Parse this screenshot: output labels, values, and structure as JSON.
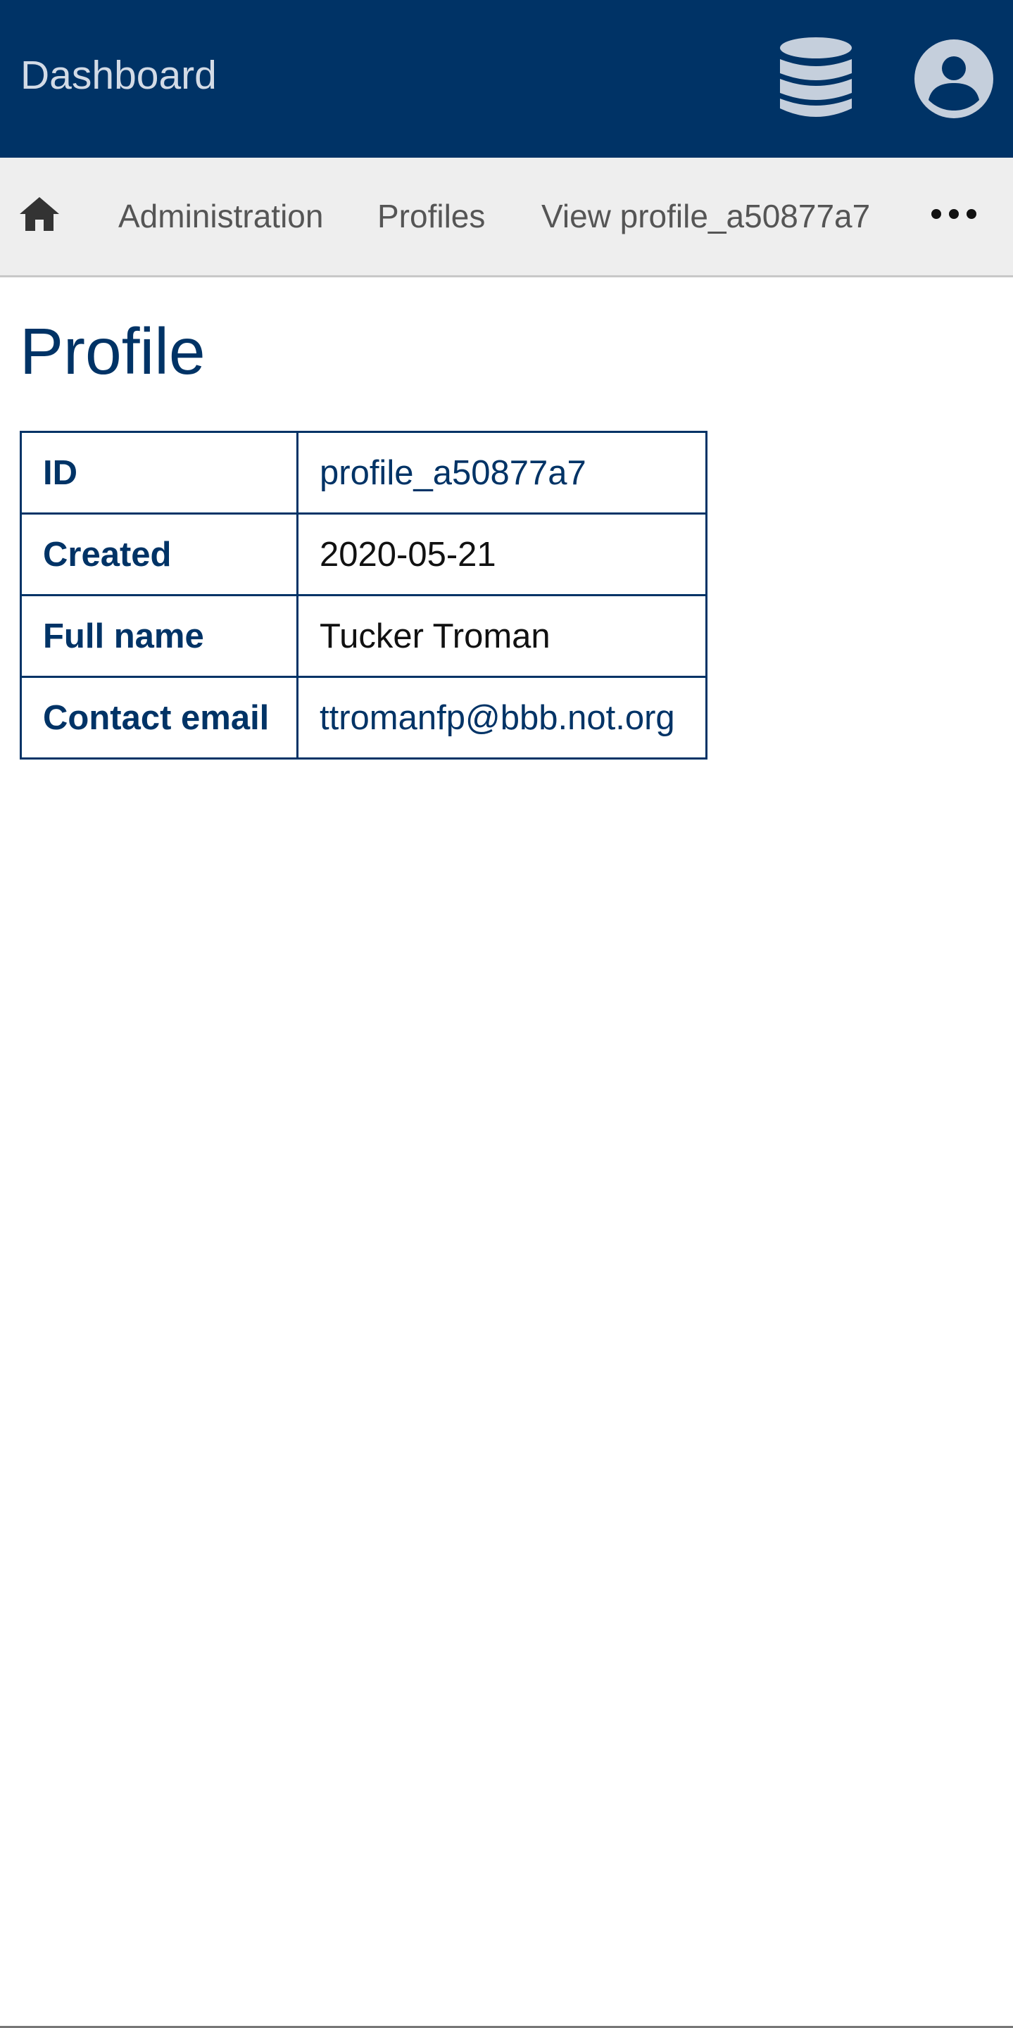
{
  "header": {
    "brand": "Dashboard",
    "icons": {
      "database": "database-icon",
      "user": "user-circle-icon"
    },
    "colors": {
      "background": "#003366",
      "icon": "#c5cfdc",
      "brand_text": "#d3dbe6"
    }
  },
  "breadcrumb": {
    "home_icon": "home-icon",
    "items": [
      {
        "label": "Administration"
      },
      {
        "label": "Profiles"
      },
      {
        "label": "View profile_a50877a7"
      }
    ],
    "more_icon": "ellipsis-icon"
  },
  "main": {
    "title": "Profile",
    "details": [
      {
        "label": "ID",
        "value": "profile_a50877a7",
        "is_link": true
      },
      {
        "label": "Created",
        "value": "2020-05-21",
        "is_link": false
      },
      {
        "label": "Full name",
        "value": "Tucker Troman",
        "is_link": false
      },
      {
        "label": "Contact email",
        "value": "ttromanfp@bbb.not.org",
        "is_link": true
      }
    ]
  }
}
